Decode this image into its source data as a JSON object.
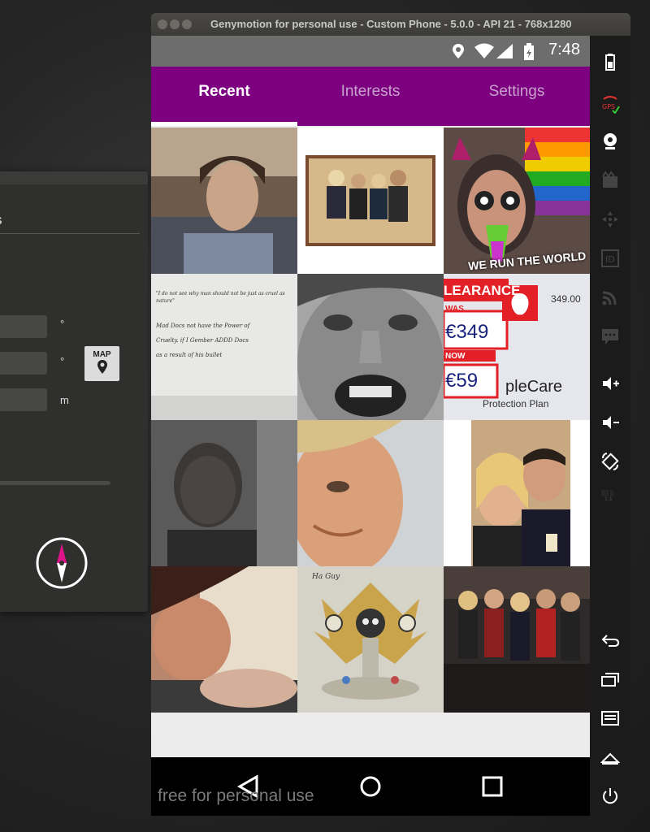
{
  "background_window": {
    "title_partial": "s",
    "units": [
      "°",
      "°",
      "m"
    ],
    "map_button_label": "MAP"
  },
  "emulator": {
    "title": "Genymotion for personal use - Custom Phone - 5.0.0 - API 21 - 768x1280",
    "watermark": "free for personal use"
  },
  "status_bar": {
    "time": "7:48"
  },
  "tabs": [
    {
      "label": "Recent",
      "active": true
    },
    {
      "label": "Interests",
      "active": false
    },
    {
      "label": "Settings",
      "active": false
    }
  ],
  "photos": {
    "captions": {
      "sticker": "WE RUN THE WORLD",
      "sign_clearance": "LEARANCE",
      "sign_was": "WAS",
      "sign_price_old": "€349",
      "sign_now": "NOW",
      "sign_price_new": "€59",
      "sign_brand": "pleCare",
      "sign_plan": "Protection Plan",
      "sign_price_tag": "349.00",
      "note_line1": "Mad Docs not have the Power of",
      "note_line2": "Cruelty. if I Gember ADDD Docs",
      "note_line3": "as a result of his bullet",
      "note_quote": "\"I do not see why man should not be just as cruel as nature\"",
      "sketch_caption": "Ha Guy"
    }
  },
  "colors": {
    "tabbar": "#7d0080",
    "status_bar": "#6d6d6d",
    "tab_inactive_text": "#c9a2cb"
  }
}
